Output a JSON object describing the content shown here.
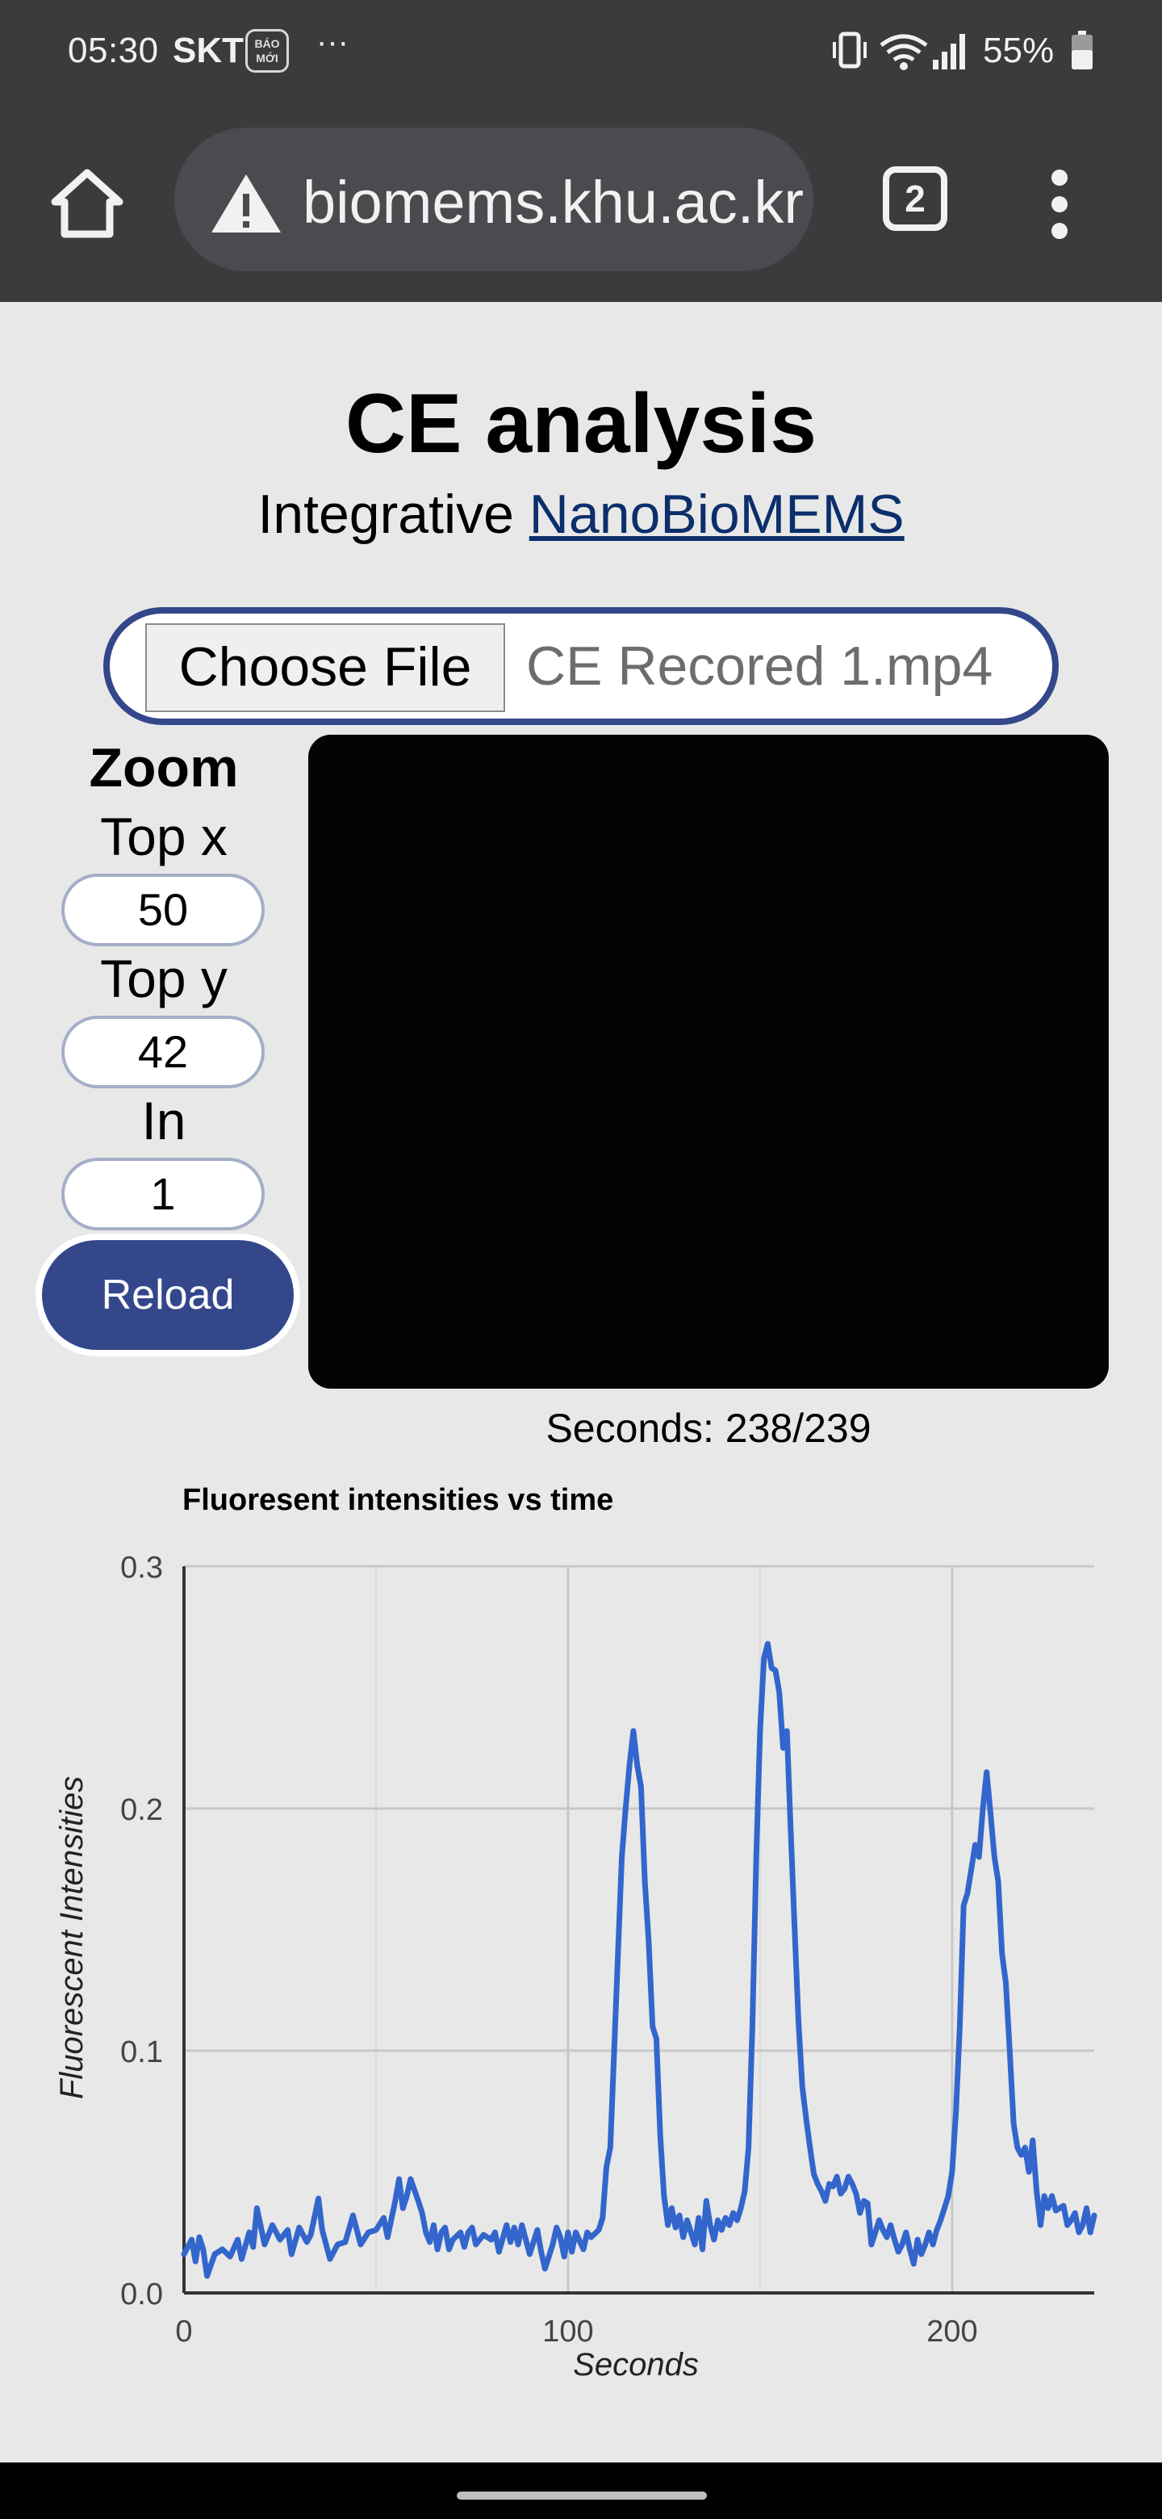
{
  "status_bar": {
    "time": "05:30",
    "carrier": "SKT",
    "news_badge": "BÁO MỚI",
    "more": "···",
    "battery_percent": "55%",
    "icons": [
      "vibrate-icon",
      "wifi-icon",
      "signal-icon",
      "battery-icon"
    ]
  },
  "browser": {
    "url": "nanobiomems.khu.ac.kr",
    "url_visible": "omems.khu.ac.kr",
    "tab_count": "2",
    "icons": [
      "home-icon",
      "warning-icon",
      "tabs-icon",
      "more-vert-icon"
    ]
  },
  "page": {
    "title": "CE analysis",
    "subtitle_prefix": "Integrative",
    "subtitle_link": "NanoBioMEMS",
    "file": {
      "button_label": "Choose File",
      "file_name": "CE Recored 1.mp4"
    },
    "zoom": {
      "title": "Zoom",
      "top_x_label": "Top x",
      "top_x_value": "50",
      "top_y_label": "Top y",
      "top_y_value": "42",
      "in_label": "In",
      "in_value": "1",
      "reload_label": "Reload"
    },
    "seconds_readout": "Seconds: 238/239"
  },
  "colors": {
    "accent": "#34478a",
    "link": "#0b2f6b",
    "line": "#3366cc",
    "chrome": "#3a3b3d"
  },
  "chart_data": {
    "type": "line",
    "title": "Fluoresent intensities vs time",
    "xlabel": "Seconds",
    "ylabel": "Fluorescent Intensities",
    "xlim": [
      0,
      237
    ],
    "ylim": [
      0,
      0.3
    ],
    "xticks": [
      0,
      100,
      200
    ],
    "yticks": [
      0.0,
      0.1,
      0.2,
      0.3
    ],
    "ytick_labels": [
      "0.0",
      "0.1",
      "0.2",
      "0.3"
    ],
    "xtick_labels": [
      "0",
      "100",
      "200"
    ],
    "grid": true,
    "series": [
      {
        "points": [
          [
            0,
            0.016
          ],
          [
            2,
            0.022
          ],
          [
            3,
            0.013
          ],
          [
            4,
            0.023
          ],
          [
            5,
            0.018
          ],
          [
            6,
            0.007
          ],
          [
            8,
            0.016
          ],
          [
            10,
            0.018
          ],
          [
            12,
            0.015
          ],
          [
            14,
            0.022
          ],
          [
            15,
            0.014
          ],
          [
            17,
            0.025
          ],
          [
            18,
            0.019
          ],
          [
            19,
            0.035
          ],
          [
            21,
            0.02
          ],
          [
            23,
            0.028
          ],
          [
            25,
            0.022
          ],
          [
            27,
            0.026
          ],
          [
            28,
            0.016
          ],
          [
            30,
            0.027
          ],
          [
            32,
            0.021
          ],
          [
            33,
            0.024
          ],
          [
            35,
            0.039
          ],
          [
            36,
            0.026
          ],
          [
            38,
            0.014
          ],
          [
            40,
            0.02
          ],
          [
            42,
            0.021
          ],
          [
            44,
            0.032
          ],
          [
            46,
            0.02
          ],
          [
            48,
            0.025
          ],
          [
            50,
            0.026
          ],
          [
            52,
            0.031
          ],
          [
            53,
            0.023
          ],
          [
            55,
            0.038
          ],
          [
            56,
            0.047
          ],
          [
            57,
            0.035
          ],
          [
            58,
            0.04
          ],
          [
            59,
            0.047
          ],
          [
            61,
            0.038
          ],
          [
            62,
            0.033
          ],
          [
            63,
            0.025
          ],
          [
            64,
            0.021
          ],
          [
            65,
            0.028
          ],
          [
            66,
            0.018
          ],
          [
            67,
            0.025
          ],
          [
            68,
            0.027
          ],
          [
            69,
            0.018
          ],
          [
            70,
            0.022
          ],
          [
            72,
            0.025
          ],
          [
            73,
            0.019
          ],
          [
            74,
            0.025
          ],
          [
            75,
            0.027
          ],
          [
            76,
            0.02
          ],
          [
            78,
            0.024
          ],
          [
            80,
            0.022
          ],
          [
            81,
            0.025
          ],
          [
            82,
            0.017
          ],
          [
            84,
            0.028
          ],
          [
            85,
            0.021
          ],
          [
            86,
            0.027
          ],
          [
            87,
            0.02
          ],
          [
            88,
            0.028
          ],
          [
            89,
            0.022
          ],
          [
            90,
            0.016
          ],
          [
            91,
            0.021
          ],
          [
            92,
            0.026
          ],
          [
            93,
            0.017
          ],
          [
            94,
            0.01
          ],
          [
            96,
            0.02
          ],
          [
            97,
            0.027
          ],
          [
            98,
            0.023
          ],
          [
            99,
            0.015
          ],
          [
            100,
            0.025
          ],
          [
            101,
            0.017
          ],
          [
            102,
            0.025
          ],
          [
            104,
            0.018
          ],
          [
            105,
            0.025
          ],
          [
            106,
            0.023
          ],
          [
            108,
            0.026
          ],
          [
            109,
            0.031
          ],
          [
            110,
            0.052
          ],
          [
            111,
            0.06
          ],
          [
            112,
            0.1
          ],
          [
            113,
            0.14
          ],
          [
            114,
            0.18
          ],
          [
            115,
            0.2
          ],
          [
            116,
            0.218
          ],
          [
            117,
            0.232
          ],
          [
            118,
            0.218
          ],
          [
            119,
            0.209
          ],
          [
            120,
            0.17
          ],
          [
            121,
            0.145
          ],
          [
            122,
            0.11
          ],
          [
            123,
            0.105
          ],
          [
            124,
            0.065
          ],
          [
            125,
            0.04
          ],
          [
            126,
            0.028
          ],
          [
            127,
            0.035
          ],
          [
            128,
            0.027
          ],
          [
            129,
            0.032
          ],
          [
            130,
            0.023
          ],
          [
            131,
            0.03
          ],
          [
            132,
            0.025
          ],
          [
            133,
            0.02
          ],
          [
            134,
            0.031
          ],
          [
            135,
            0.018
          ],
          [
            136,
            0.038
          ],
          [
            137,
            0.028
          ],
          [
            138,
            0.022
          ],
          [
            139,
            0.03
          ],
          [
            140,
            0.026
          ],
          [
            141,
            0.031
          ],
          [
            142,
            0.028
          ],
          [
            143,
            0.033
          ],
          [
            144,
            0.03
          ],
          [
            145,
            0.035
          ],
          [
            146,
            0.042
          ],
          [
            147,
            0.06
          ],
          [
            148,
            0.11
          ],
          [
            149,
            0.18
          ],
          [
            150,
            0.232
          ],
          [
            151,
            0.262
          ],
          [
            152,
            0.268
          ],
          [
            153,
            0.258
          ],
          [
            154,
            0.257
          ],
          [
            155,
            0.248
          ],
          [
            156,
            0.225
          ],
          [
            157,
            0.232
          ],
          [
            158,
            0.19
          ],
          [
            159,
            0.15
          ],
          [
            160,
            0.112
          ],
          [
            161,
            0.085
          ],
          [
            162,
            0.072
          ],
          [
            163,
            0.06
          ],
          [
            164,
            0.049
          ],
          [
            165,
            0.045
          ],
          [
            166,
            0.042
          ],
          [
            167,
            0.038
          ],
          [
            168,
            0.045
          ],
          [
            169,
            0.044
          ],
          [
            170,
            0.048
          ],
          [
            171,
            0.041
          ],
          [
            172,
            0.043
          ],
          [
            173,
            0.048
          ],
          [
            174,
            0.045
          ],
          [
            175,
            0.041
          ],
          [
            176,
            0.033
          ],
          [
            177,
            0.038
          ],
          [
            178,
            0.037
          ],
          [
            179,
            0.02
          ],
          [
            180,
            0.025
          ],
          [
            181,
            0.03
          ],
          [
            182,
            0.026
          ],
          [
            183,
            0.023
          ],
          [
            184,
            0.028
          ],
          [
            185,
            0.022
          ],
          [
            186,
            0.017
          ],
          [
            187,
            0.02
          ],
          [
            188,
            0.025
          ],
          [
            189,
            0.018
          ],
          [
            190,
            0.012
          ],
          [
            191,
            0.022
          ],
          [
            192,
            0.016
          ],
          [
            193,
            0.02
          ],
          [
            194,
            0.025
          ],
          [
            195,
            0.02
          ],
          [
            196,
            0.026
          ],
          [
            197,
            0.03
          ],
          [
            198,
            0.035
          ],
          [
            199,
            0.04
          ],
          [
            200,
            0.05
          ],
          [
            201,
            0.075
          ],
          [
            202,
            0.11
          ],
          [
            203,
            0.16
          ],
          [
            204,
            0.165
          ],
          [
            205,
            0.175
          ],
          [
            206,
            0.185
          ],
          [
            207,
            0.18
          ],
          [
            208,
            0.2
          ],
          [
            209,
            0.215
          ],
          [
            210,
            0.198
          ],
          [
            211,
            0.18
          ],
          [
            212,
            0.17
          ],
          [
            213,
            0.14
          ],
          [
            214,
            0.128
          ],
          [
            215,
            0.1
          ],
          [
            216,
            0.07
          ],
          [
            217,
            0.06
          ],
          [
            218,
            0.057
          ],
          [
            219,
            0.06
          ],
          [
            220,
            0.05
          ],
          [
            221,
            0.063
          ],
          [
            222,
            0.042
          ],
          [
            223,
            0.028
          ],
          [
            224,
            0.04
          ],
          [
            225,
            0.035
          ],
          [
            226,
            0.04
          ],
          [
            227,
            0.034
          ],
          [
            228,
            0.035
          ],
          [
            229,
            0.036
          ],
          [
            230,
            0.028
          ],
          [
            231,
            0.03
          ],
          [
            232,
            0.033
          ],
          [
            233,
            0.025
          ],
          [
            234,
            0.028
          ],
          [
            235,
            0.035
          ],
          [
            236,
            0.025
          ],
          [
            237,
            0.032
          ]
        ]
      }
    ]
  }
}
